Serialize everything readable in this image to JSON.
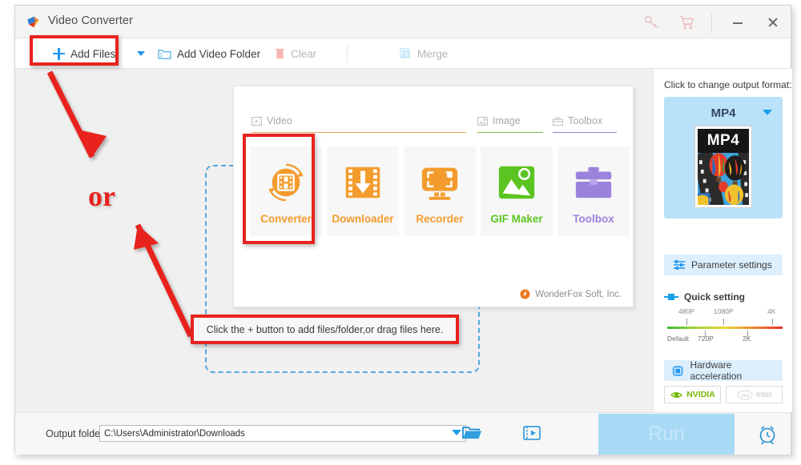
{
  "window": {
    "title": "Video Converter",
    "logo_icon": "wonderfox-logo-icon",
    "controls": {
      "key_icon": "key-icon",
      "cart_icon": "cart-icon",
      "minimize": "minimize-icon",
      "close": "close-icon"
    }
  },
  "toolbar": {
    "add_files": "Add Files",
    "add_files_icon": "plus-icon",
    "dropdown_caret": "caret-down-icon",
    "add_video_folder": "Add Video Folder",
    "add_video_folder_icon": "folder-video-icon",
    "clear": "Clear",
    "clear_icon": "trash-icon",
    "merge": "Merge",
    "merge_icon": "merge-squares-icon"
  },
  "module_panel": {
    "tabs": [
      {
        "label": "Video",
        "icon": "video-frame-icon",
        "color": "#e8a35c"
      },
      {
        "label": "Image",
        "icon": "image-icon",
        "color": "#6cc04a"
      },
      {
        "label": "Toolbox",
        "icon": "toolbox-icon",
        "color": "#8f7fd4"
      }
    ],
    "modules": [
      {
        "label": "Converter",
        "icon": "converter-icon",
        "color": "#f39c2d"
      },
      {
        "label": "Downloader",
        "icon": "downloader-icon",
        "color": "#f39c2d"
      },
      {
        "label": "Recorder",
        "icon": "recorder-icon",
        "color": "#f39c2d"
      },
      {
        "label": "GIF Maker",
        "icon": "gif-maker-icon",
        "color": "#5cc422"
      },
      {
        "label": "Toolbox",
        "icon": "toolbox-big-icon",
        "color": "#9b83dd"
      }
    ],
    "brand": "WonderFox Soft, Inc.",
    "brand_icon": "wonderfox-flame-icon"
  },
  "annotations": {
    "or_text": "or",
    "drop_hint": "Click the + button to add files/folder,or drag files here.",
    "highlight_color": "#e8231f",
    "arrow_top_icon": "red-arrow-down-right-icon",
    "arrow_bottom_icon": "red-arrow-up-right-icon"
  },
  "sidebar": {
    "format_prompt": "Click to change output format:",
    "format_name": "MP4",
    "format_caret_icon": "caret-down-icon",
    "thumbnail_label": "MP4",
    "parameter_settings": "Parameter settings",
    "parameter_settings_icon": "sliders-icon",
    "quick_setting": "Quick setting",
    "quick_setting_icon": "slider-handle-icon",
    "quality_top_labels": [
      "480P",
      "1080P",
      "4K"
    ],
    "quality_bottom_labels": [
      "Default",
      "720P",
      "2K"
    ],
    "hardware_acceleration": "Hardware acceleration",
    "hardware_acceleration_icon": "cpu-chip-icon",
    "gpu_buttons": [
      {
        "label": "NVIDIA",
        "icon": "nvidia-eye-icon",
        "enabled": true
      },
      {
        "label": "Intel",
        "icon": "intel-logo-icon",
        "enabled": false
      }
    ]
  },
  "bottom": {
    "output_folder_label": "Output folder:",
    "output_folder_value": "C:\\Users\\Administrator\\Downloads",
    "output_folder_placeholder": "C:\\Users\\Administrator\\Downloads",
    "dropdown_icon": "caret-down-icon",
    "open_folder_icon": "open-folder-icon",
    "video_preview_icon": "video-file-icon",
    "run_label": "Run",
    "alarm_icon": "alarm-clock-icon"
  }
}
